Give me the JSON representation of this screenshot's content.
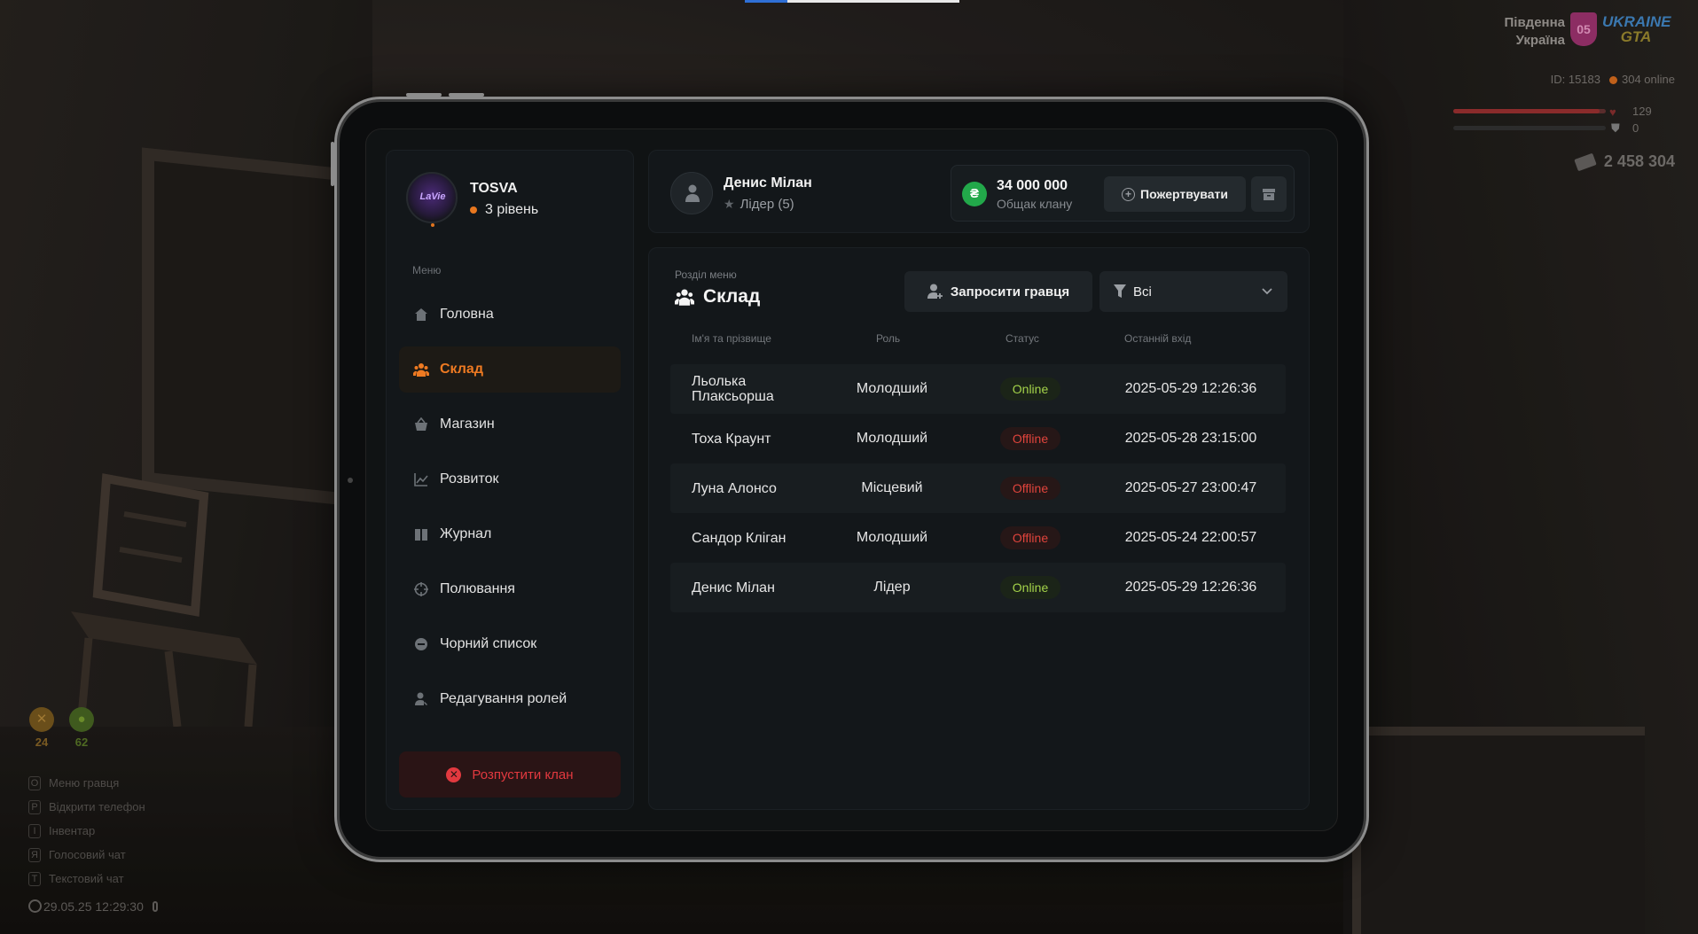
{
  "hud": {
    "region_line1": "Південна",
    "region_line2": "Україна",
    "region_badge": "05",
    "logo_line1": "UKRAINE",
    "logo_line2": "GTA",
    "player_id": "ID: 15183",
    "online": "304 online",
    "health": "129",
    "armor": "0",
    "money": "2 458 304",
    "food": "24",
    "water": "62",
    "hints": [
      {
        "key": "O",
        "label": "Меню гравця"
      },
      {
        "key": "P",
        "label": "Відкрити телефон"
      },
      {
        "key": "I",
        "label": "Інвентар"
      },
      {
        "key": "Я",
        "label": "Голосовий чат"
      },
      {
        "key": "T",
        "label": "Текстовий чат"
      }
    ],
    "datetime": "29.05.25 12:29:30"
  },
  "clan": {
    "name": "TOSVA",
    "level": "3 рівень",
    "avatar_text": "LaVie"
  },
  "sidebar": {
    "caption": "Меню",
    "items": [
      {
        "label": "Головна",
        "icon": "home-icon"
      },
      {
        "label": "Склад",
        "icon": "people-icon",
        "active": true
      },
      {
        "label": "Магазин",
        "icon": "basket-icon"
      },
      {
        "label": "Розвиток",
        "icon": "chart-icon"
      },
      {
        "label": "Журнал",
        "icon": "book-icon"
      },
      {
        "label": "Полювання",
        "icon": "crosshair-icon"
      },
      {
        "label": "Чорний список",
        "icon": "block-icon"
      },
      {
        "label": "Редагування ролей",
        "icon": "user-edit-icon"
      }
    ],
    "disband_label": "Розпустити клан"
  },
  "leader": {
    "name": "Денис Мілан",
    "role": "Лідер (5)"
  },
  "bank": {
    "amount": "34 000 000",
    "label": "Общак клану",
    "donate_label": "Пожертвувати"
  },
  "section": {
    "caption": "Розділ меню",
    "title": "Склад",
    "invite_label": "Запросити гравця",
    "filter_value": "Всі"
  },
  "table": {
    "columns": [
      "Ім'я та прізвище",
      "Роль",
      "Статус",
      "Останній вхід"
    ],
    "rows": [
      {
        "name": "Льолька Плаксьорша",
        "role": "Молодший",
        "status": "Online",
        "last": "2025-05-29 12:26:36"
      },
      {
        "name": "Тоха Краунт",
        "role": "Молодший",
        "status": "Offline",
        "last": "2025-05-28 23:15:00"
      },
      {
        "name": "Луна Алонсо",
        "role": "Місцевий",
        "status": "Offline",
        "last": "2025-05-27 23:00:47"
      },
      {
        "name": "Сандор Кліган",
        "role": "Молодший",
        "status": "Offline",
        "last": "2025-05-24 22:00:57"
      },
      {
        "name": "Денис Мілан",
        "role": "Лідер",
        "status": "Online",
        "last": "2025-05-29 12:26:36"
      }
    ]
  },
  "colors": {
    "accent": "#ee7a22",
    "online": "#a4d34a",
    "offline": "#e0443c",
    "danger": "#e2393f",
    "coin": "#22a84a"
  }
}
